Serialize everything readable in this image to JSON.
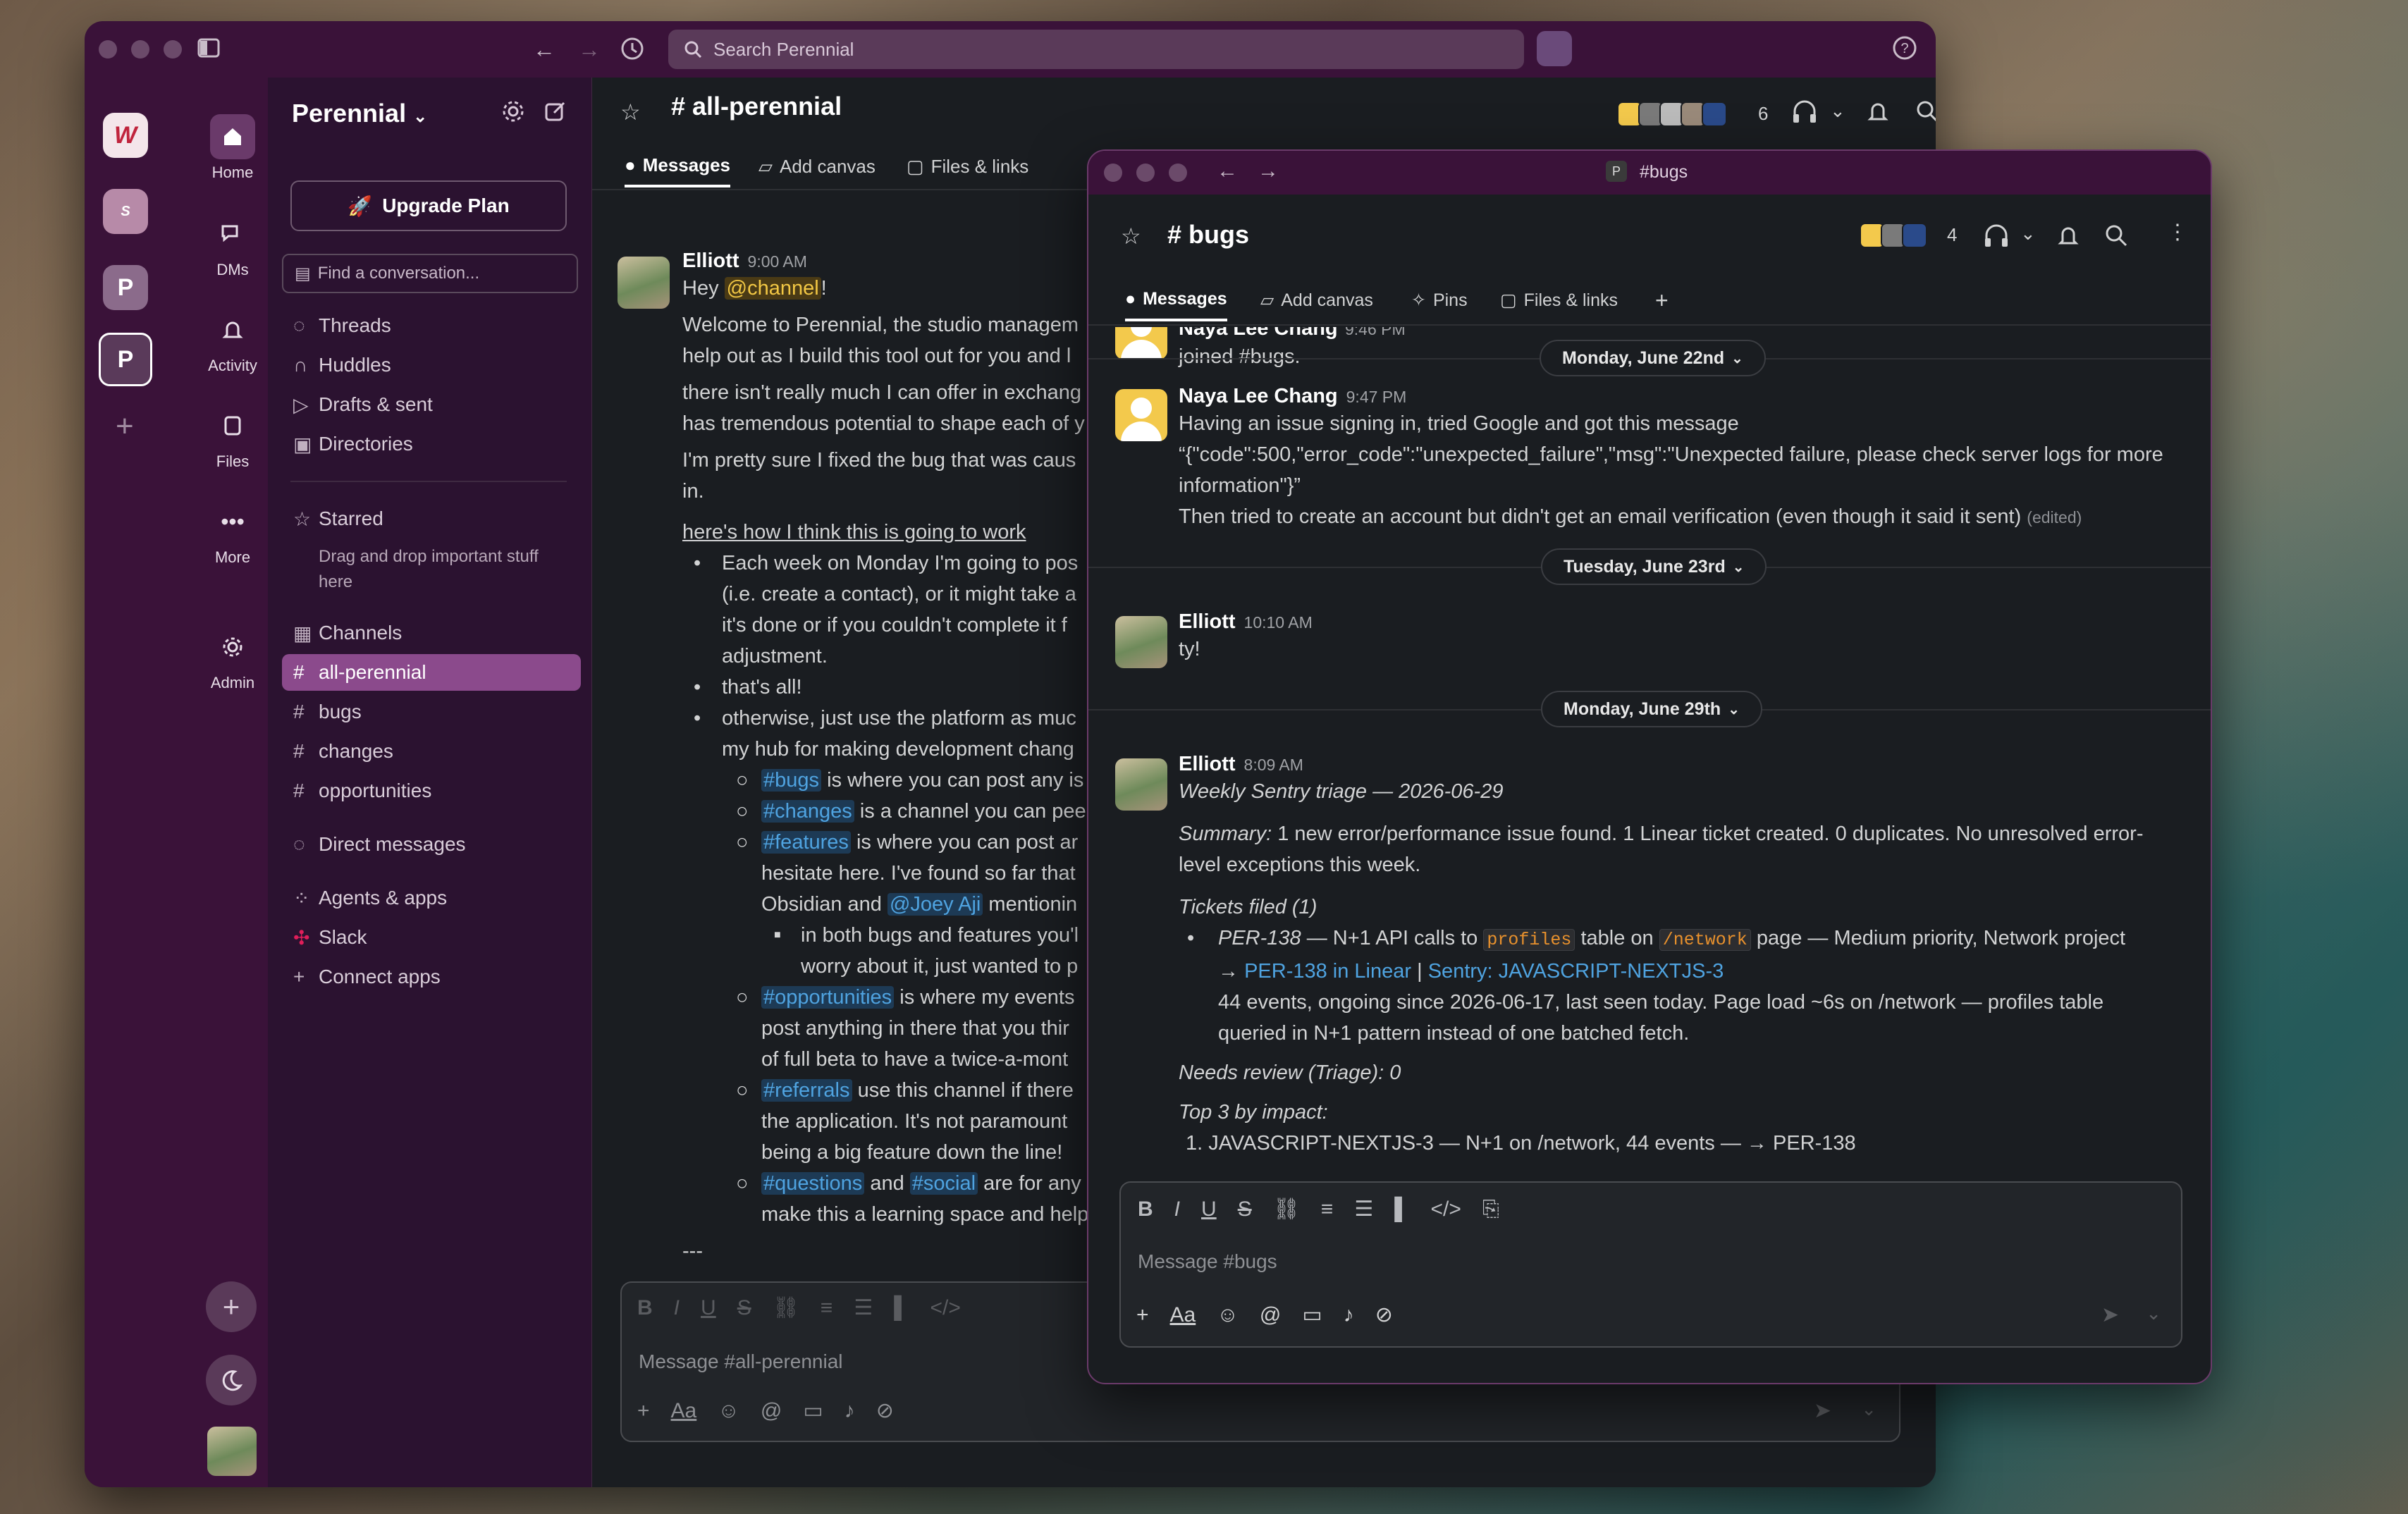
{
  "colors": {
    "aubergine": "#3a1239",
    "active_channel": "#8b4a8c",
    "link": "#4fa3e0",
    "mention": "#f2c744"
  },
  "main": {
    "search_placeholder": "Search Perennial",
    "workspace": "Perennial",
    "upgrade_label": "Upgrade Plan",
    "find_placeholder": "Find a conversation...",
    "nav": [
      {
        "label": "Home",
        "icon": "home-icon"
      },
      {
        "label": "DMs",
        "icon": "dms-icon"
      },
      {
        "label": "Activity",
        "icon": "bell-icon"
      },
      {
        "label": "Files",
        "icon": "files-icon"
      },
      {
        "label": "More",
        "icon": "more-icon"
      },
      {
        "label": "Admin",
        "icon": "gear-icon"
      }
    ],
    "sidebar": {
      "threads": "Threads",
      "huddles": "Huddles",
      "drafts": "Drafts & sent",
      "directories": "Directories",
      "starred": "Starred",
      "starred_hint": "Drag and drop important stuff here",
      "channels": "Channels",
      "channel_list": [
        "all-perennial",
        "bugs",
        "changes",
        "opportunities"
      ],
      "direct_messages": "Direct messages",
      "agents": "Agents & apps",
      "slack": "Slack",
      "connect": "Connect apps"
    },
    "channel": {
      "name": "# all-perennial",
      "member_count": "6",
      "tabs": [
        "Messages",
        "Add canvas",
        "Files & links"
      ],
      "composer_placeholder": "Message #all-perennial"
    },
    "message": {
      "author": "Elliott",
      "time": "9:00 AM",
      "greeting": "Hey",
      "greeting_mention": "@channel",
      "greeting_end": "!",
      "p1": "Welcome to Perennial, the studio managem",
      "p1b": "help out as I build this tool out for you and l",
      "p2": "there isn't really much I can offer in exchang",
      "p2b": "has tremendous potential to shape each of y",
      "p3": "I'm pretty sure I fixed the bug that was caus",
      "p3b": "in.",
      "heading": "here's how I think this is going to work",
      "b1": "Each week on Monday I'm going to pos",
      "b1b": "(i.e. create a contact), or it might take a",
      "b1c": "it's done or if you couldn't complete it f",
      "b1d": "adjustment.",
      "b2": "that's all!",
      "b3": "otherwise, just use the platform as muc",
      "b3b": "my hub for making development chang",
      "s1_link": "#bugs",
      "s1": "is where you can post any is",
      "s2_link": "#changes",
      "s2": "is a channel you can pee",
      "s3_link": "#features",
      "s3": "is where you can post ar",
      "s3b": "hesitate here. I've found so far that",
      "s3c": "Obsidian and",
      "s3c_mention": "@Joey Aji",
      "s3c_end": "mentionin",
      "ss1": "in both bugs and features you'l",
      "ss1b": "worry about it, just wanted to p",
      "s4_link": "#opportunities",
      "s4": "is where my events",
      "s4b": "post anything in there that you thir",
      "s4c": "of full beta to have a twice-a-mont",
      "s5_link": "#referrals",
      "s5": "use this channel if there",
      "s5b": "the application. It's not paramount",
      "s5c": "being a big feature down the line!",
      "s6_link": "#questions",
      "s6_and": "and",
      "s6_link2": "#social",
      "s6": "are for any",
      "s6b": "make this a learning space and help",
      "rule": "---"
    }
  },
  "bugs": {
    "title_tab": "#bugs",
    "channel_name": "# bugs",
    "member_count": "4",
    "tabs": [
      "Messages",
      "Add canvas",
      "Pins",
      "Files & links"
    ],
    "date1": "Monday, June 22nd",
    "date2": "Tuesday, June 23rd",
    "date3": "Monday, June 29th",
    "top_partial_name": "Naya Lee Chang",
    "top_partial_time": "9:46 PM",
    "joined": "joined #bugs.",
    "m1": {
      "author": "Naya Lee Chang",
      "time": "9:47 PM",
      "l1": "Having an issue signing in, tried Google and got this message",
      "l2": "“{\"code\":500,\"error_code\":\"unexpected_failure\",\"msg\":\"Unexpected failure, please check server logs for more",
      "l3": "information\"}”",
      "l4": "Then tried to create an account but didn't get an email verification (even though it said it sent)",
      "edited": "(edited)"
    },
    "m2": {
      "author": "Elliott",
      "time": "10:10 AM",
      "text": "ty!"
    },
    "m3": {
      "author": "Elliott",
      "time": "8:09 AM",
      "title": "Weekly Sentry triage — 2026-06-29",
      "summary_label": "Summary:",
      "summary": "1 new error/performance issue found. 1 Linear ticket created. 0 duplicates. No unresolved error-",
      "summary2": "level exceptions this week.",
      "tickets_label": "Tickets filed (1)",
      "t1_id": "PER-138",
      "t1_a": "— N+1 API calls to",
      "t1_code1": "profiles",
      "t1_b": "table on",
      "t1_code2": "/network",
      "t1_c": "page — Medium priority, Network project",
      "t1_arrow": "→",
      "t1_link1": "PER-138 in Linear",
      "t1_sep": "|",
      "t1_link2": "Sentry: JAVASCRIPT-NEXTJS-3",
      "t1_d": "44 events, ongoing since 2026-06-17, last seen today. Page load ~6s on /network — profiles table",
      "t1_e": "queried in N+1 pattern instead of one batched fetch.",
      "needs_review": "Needs review (Triage): 0",
      "top3": "Top 3 by impact:",
      "top3_1": "1.  JAVASCRIPT-NEXTJS-3 — N+1 on /network, 44 events — → PER-138"
    },
    "composer_placeholder": "Message #bugs"
  }
}
